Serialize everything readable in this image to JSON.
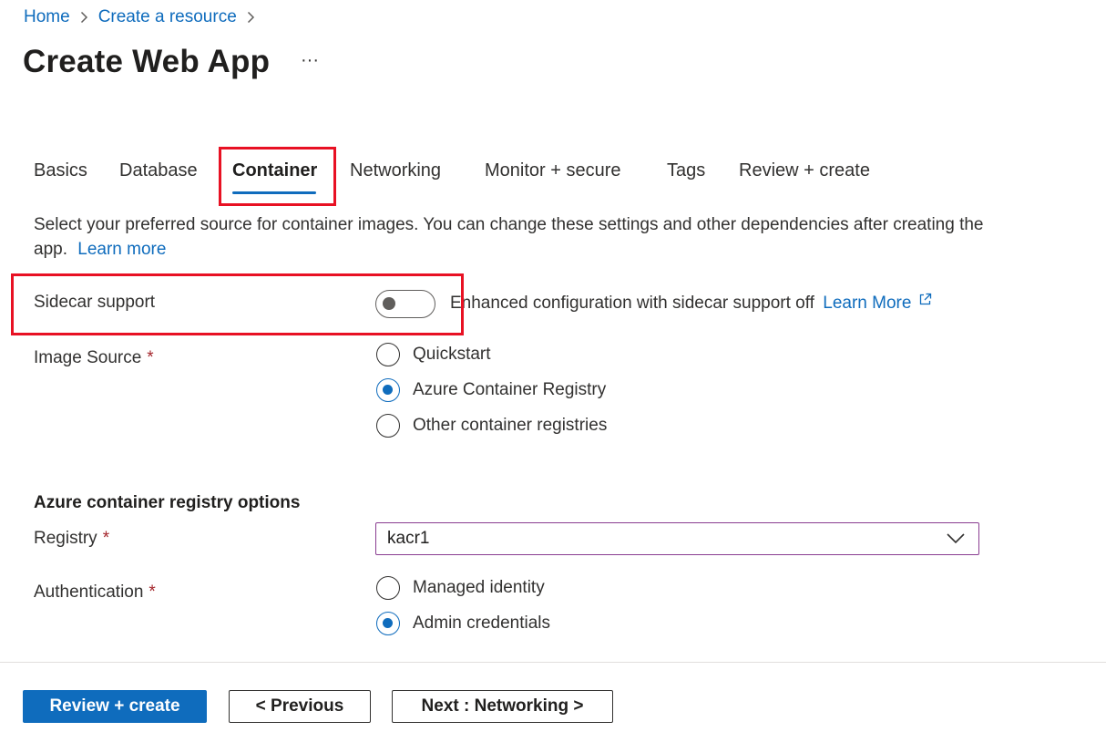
{
  "breadcrumb": {
    "items": [
      "Home",
      "Create a resource"
    ]
  },
  "page": {
    "title": "Create Web App",
    "more_label": "···"
  },
  "tabs": [
    {
      "label": "Basics"
    },
    {
      "label": "Database"
    },
    {
      "label": "Container",
      "active": true
    },
    {
      "label": "Networking"
    },
    {
      "label": "Monitor + secure"
    },
    {
      "label": "Tags"
    },
    {
      "label": "Review + create"
    }
  ],
  "description": {
    "text": "Select your preferred source for container images. You can change these settings and other dependencies after creating the app.",
    "learn_more": "Learn more"
  },
  "sidecar": {
    "label": "Sidecar support",
    "toggle_on": false,
    "status_text": "Enhanced configuration with sidecar support off",
    "learn_more": "Learn More"
  },
  "image_source": {
    "label": "Image Source",
    "required_mark": "*",
    "options": [
      "Quickstart",
      "Azure Container Registry",
      "Other container registries"
    ],
    "selected": "Azure Container Registry"
  },
  "acr_options": {
    "heading": "Azure container registry options",
    "registry": {
      "label": "Registry",
      "required_mark": "*",
      "value": "kacr1"
    },
    "authentication": {
      "label": "Authentication",
      "required_mark": "*",
      "options": [
        "Managed identity",
        "Admin credentials"
      ],
      "selected": "Admin credentials"
    }
  },
  "footer": {
    "review_create": "Review + create",
    "previous": "< Previous",
    "next": "Next : Networking >"
  },
  "colors": {
    "accent": "#0f6cbd",
    "highlight_box": "#e81123",
    "required": "#a4262c",
    "select_border": "#8a3d91"
  }
}
